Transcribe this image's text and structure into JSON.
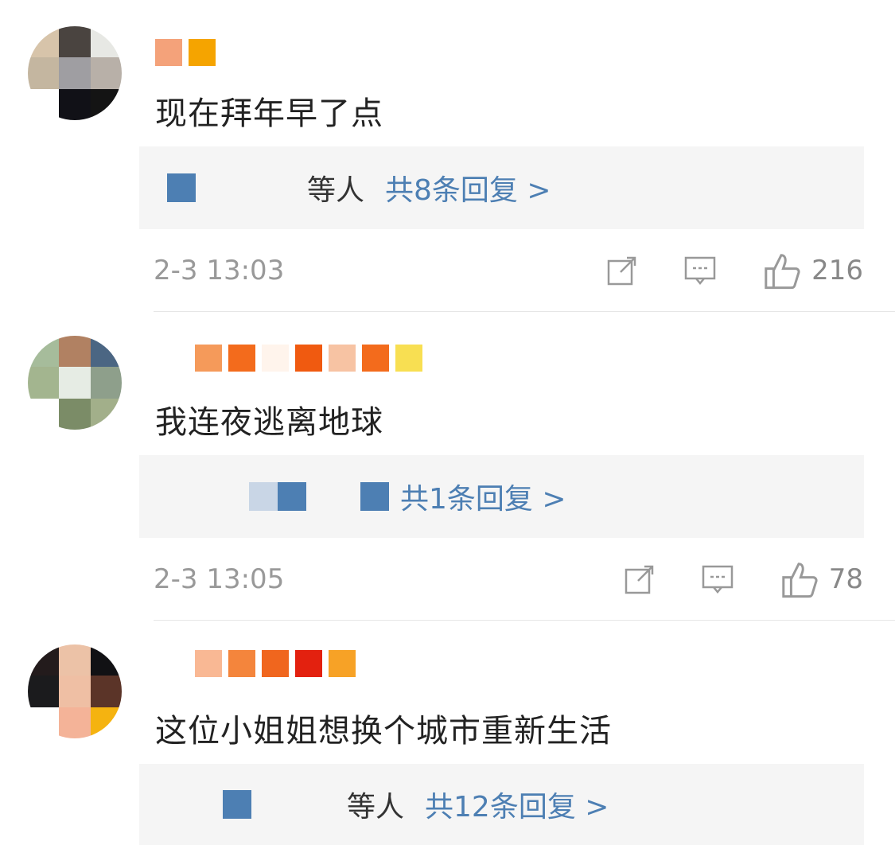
{
  "comments": [
    {
      "text": "现在拜年早了点",
      "name_blurs": [
        "#f4a27a",
        "#f5a400"
      ],
      "avatar": [
        "#d7c4aa",
        "#4a4440",
        "#e7e8e4",
        "#c4b6a0",
        "#9f9ea2",
        "#b8b0a8",
        "#ffffff",
        "#111117",
        "#141414"
      ],
      "reply_avatar": "#4d7fb3",
      "reply_who": "等人",
      "reply_count": "共8条回复 >",
      "time": "2-3 13:03",
      "likes": "216"
    },
    {
      "text": "我连夜逃离地球",
      "name_blurs": [
        "#f59a5a",
        "#f36b1c",
        "#fff4ec",
        "#f05a10",
        "#f7c3a3",
        "#f36b1c",
        "#f8df52"
      ],
      "avatar": [
        "#a6bc9b",
        "#b18162",
        "#4b6683",
        "#a3b58f",
        "#e6ece4",
        "#8e9f8b",
        "#ffffff",
        "#7b8c67",
        "#a2af8a"
      ],
      "reply_avatar": "#4d7fb3",
      "reply_who": "",
      "reply_count": "共1条回复 >",
      "time": "2-3 13:05",
      "likes": "78"
    },
    {
      "text": "这位小姐姐想换个城市重新生活",
      "name_blurs": [
        "#f9b894",
        "#f4853c",
        "#f0661e",
        "#e3210f",
        "#f7a226"
      ],
      "avatar": [
        "#231b1c",
        "#ecc2a7",
        "#111114",
        "#1b1b1d",
        "#efbfa4",
        "#5b3428",
        "#ffffff",
        "#f4b398",
        "#f5b310"
      ],
      "reply_avatar": "#4d7fb3",
      "reply_who": "等人",
      "reply_count": "共12条回复 >",
      "time": "",
      "likes": ""
    }
  ]
}
